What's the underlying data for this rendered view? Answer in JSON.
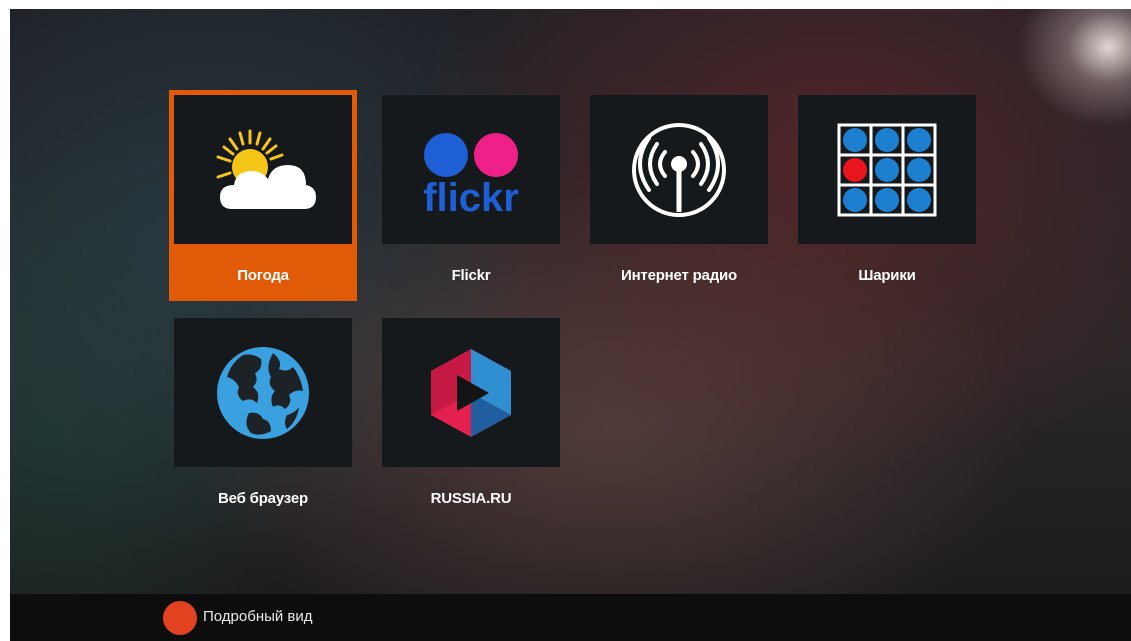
{
  "apps": [
    {
      "label": "Погода",
      "icon": "weather-icon",
      "focused": true
    },
    {
      "label": "Flickr",
      "icon": "flickr-icon",
      "logo_text": "flickr",
      "focused": false
    },
    {
      "label": "Интернет радио",
      "icon": "radio-icon",
      "focused": false
    },
    {
      "label": "Шарики",
      "icon": "balls-grid-icon",
      "focused": false
    },
    {
      "label": "Веб браузер",
      "icon": "globe-icon",
      "focused": false
    },
    {
      "label": "RUSSIA.RU",
      "icon": "russia-ru-icon",
      "focused": false
    }
  ],
  "footer": {
    "hint_label": "Подробный вид",
    "key_icon": "red-button-icon"
  },
  "colors": {
    "focus": "#e05a08",
    "tile_bg": "#15191b",
    "red_key": "#e2421f",
    "flickr_blue": "#0063dc",
    "flickr_pink": "#ff0084",
    "balls_blue": "#1d7fd0",
    "balls_red": "#e8161c"
  }
}
